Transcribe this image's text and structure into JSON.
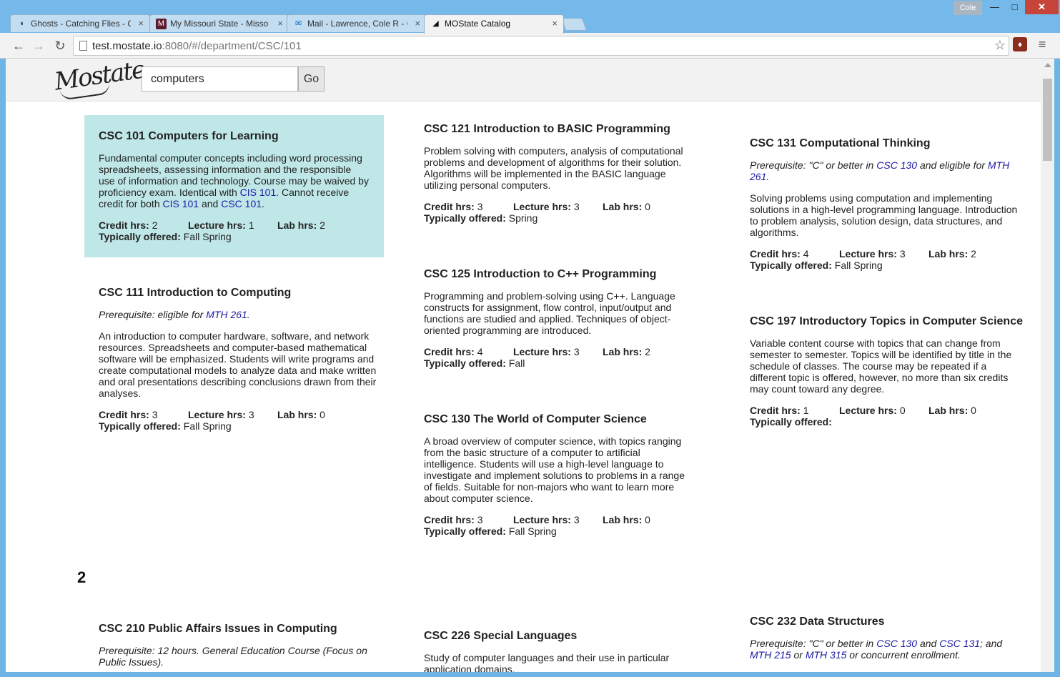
{
  "browser": {
    "tabs": [
      {
        "title": "Ghosts - Catching Flies - C",
        "icon": "headphones-icon",
        "icon_glyph": "◖",
        "icon_color": "#444"
      },
      {
        "title": "My Missouri State - Misso",
        "icon": "m-logo-icon",
        "icon_glyph": "M",
        "icon_color": "#5e1a2a"
      },
      {
        "title": "Mail - Lawrence, Cole R - C",
        "icon": "mail-icon",
        "icon_glyph": "✉",
        "icon_color": "#1a6fc4"
      },
      {
        "title": "MOState Catalog",
        "icon": "bear-icon",
        "icon_glyph": "◢",
        "icon_color": "#222"
      }
    ],
    "close_glyph": "×",
    "profile_name": "Cole",
    "url_host": "test.mostate.io",
    "url_rest": ":8080/#/department/CSC/101",
    "window_controls": {
      "minimize": "—",
      "maximize": "□",
      "close": "✕"
    },
    "nav": {
      "back": "←",
      "forward": "→",
      "reload": "↻",
      "star": "☆",
      "menu": "≡",
      "ext": "♦"
    }
  },
  "page": {
    "logo_text": "Mostate",
    "search": {
      "value": "computers",
      "button": "Go"
    },
    "labels": {
      "credit": "Credit hrs:",
      "lecture": "Lecture hrs:",
      "lab": "Lab hrs:",
      "offered": "Typically offered:"
    },
    "section_heading": "2",
    "courses": [
      {
        "title": "CSC 101 Computers for Learning",
        "desc_parts": [
          "Fundamental computer concepts including word processing spreadsheets, assessing information and the responsible use of information and technology. Course may be waived by proficiency exam. Identical with ",
          "CIS 101",
          ". Cannot receive credit for both ",
          "CIS 101",
          " and ",
          "CSC 101",
          "."
        ],
        "credit": "2",
        "lecture": "1",
        "lab": "2",
        "offered": "Fall Spring"
      },
      {
        "title": "CSC 111 Introduction to Computing",
        "prereq_parts": [
          "Prerequisite: eligible for ",
          "MTH 261",
          "."
        ],
        "desc": "An introduction to computer hardware, software, and network resources. Spreadsheets and computer-based mathematical software will be emphasized. Students will write programs and create computational models to analyze data and make written and oral presentations describing conclusions drawn from their analyses.",
        "credit": "3",
        "lecture": "3",
        "lab": "0",
        "offered": "Fall Spring"
      },
      {
        "title": "CSC 121 Introduction to BASIC Programming",
        "desc": "Problem solving with computers, analysis of computational problems and development of algorithms for their solution. Algorithms will be implemented in the BASIC language utilizing personal computers.",
        "credit": "3",
        "lecture": "3",
        "lab": "0",
        "offered": "Spring"
      },
      {
        "title": "CSC 125 Introduction to C++ Programming",
        "desc": "Programming and problem-solving using C++. Language constructs for assignment, flow control, input/output and functions are studied and applied. Techniques of object-oriented programming are introduced.",
        "credit": "4",
        "lecture": "3",
        "lab": "2",
        "offered": "Fall"
      },
      {
        "title": "CSC 130 The World of Computer Science",
        "desc": "A broad overview of computer science, with topics ranging from the basic structure of a computer to artificial intelligence. Students will use a high-level language to investigate and implement solutions to problems in a range of fields. Suitable for non-majors who want to learn more about computer science.",
        "credit": "3",
        "lecture": "3",
        "lab": "0",
        "offered": "Fall Spring"
      },
      {
        "title": "CSC 131 Computational Thinking",
        "prereq_parts": [
          "Prerequisite: \"C\" or better in ",
          "CSC 130",
          " and eligible for ",
          "MTH 261",
          "."
        ],
        "desc": "Solving problems using computation and implementing solutions in a high-level programming language. Introduction to problem analysis, solution design, data structures, and algorithms.",
        "credit": "4",
        "lecture": "3",
        "lab": "2",
        "offered": "Fall Spring"
      },
      {
        "title": "CSC 197 Introductory Topics in Computer Science",
        "desc": "Variable content course with topics that can change from semester to semester. Topics will be identified by title in the schedule of classes. The course may be repeated if a different topic is offered, however, no more than six credits may count toward any degree.",
        "credit": "1",
        "lecture": "0",
        "lab": "0",
        "offered": ""
      },
      {
        "title": "CSC 210 Public Affairs Issues in Computing",
        "prereq_parts": [
          "Prerequisite: 12 hours. General Education Course (Focus on Public Issues)."
        ]
      },
      {
        "title": "CSC 226 Special Languages",
        "desc": "Study of computer languages and their use in particular application domains."
      },
      {
        "title": "CSC 232 Data Structures",
        "prereq_parts": [
          "Prerequisite: \"C\" or better in ",
          "CSC 130",
          " and ",
          "CSC 131",
          "; and ",
          "MTH 215",
          " or ",
          "MTH 315",
          " or concurrent enrollment."
        ]
      }
    ]
  }
}
